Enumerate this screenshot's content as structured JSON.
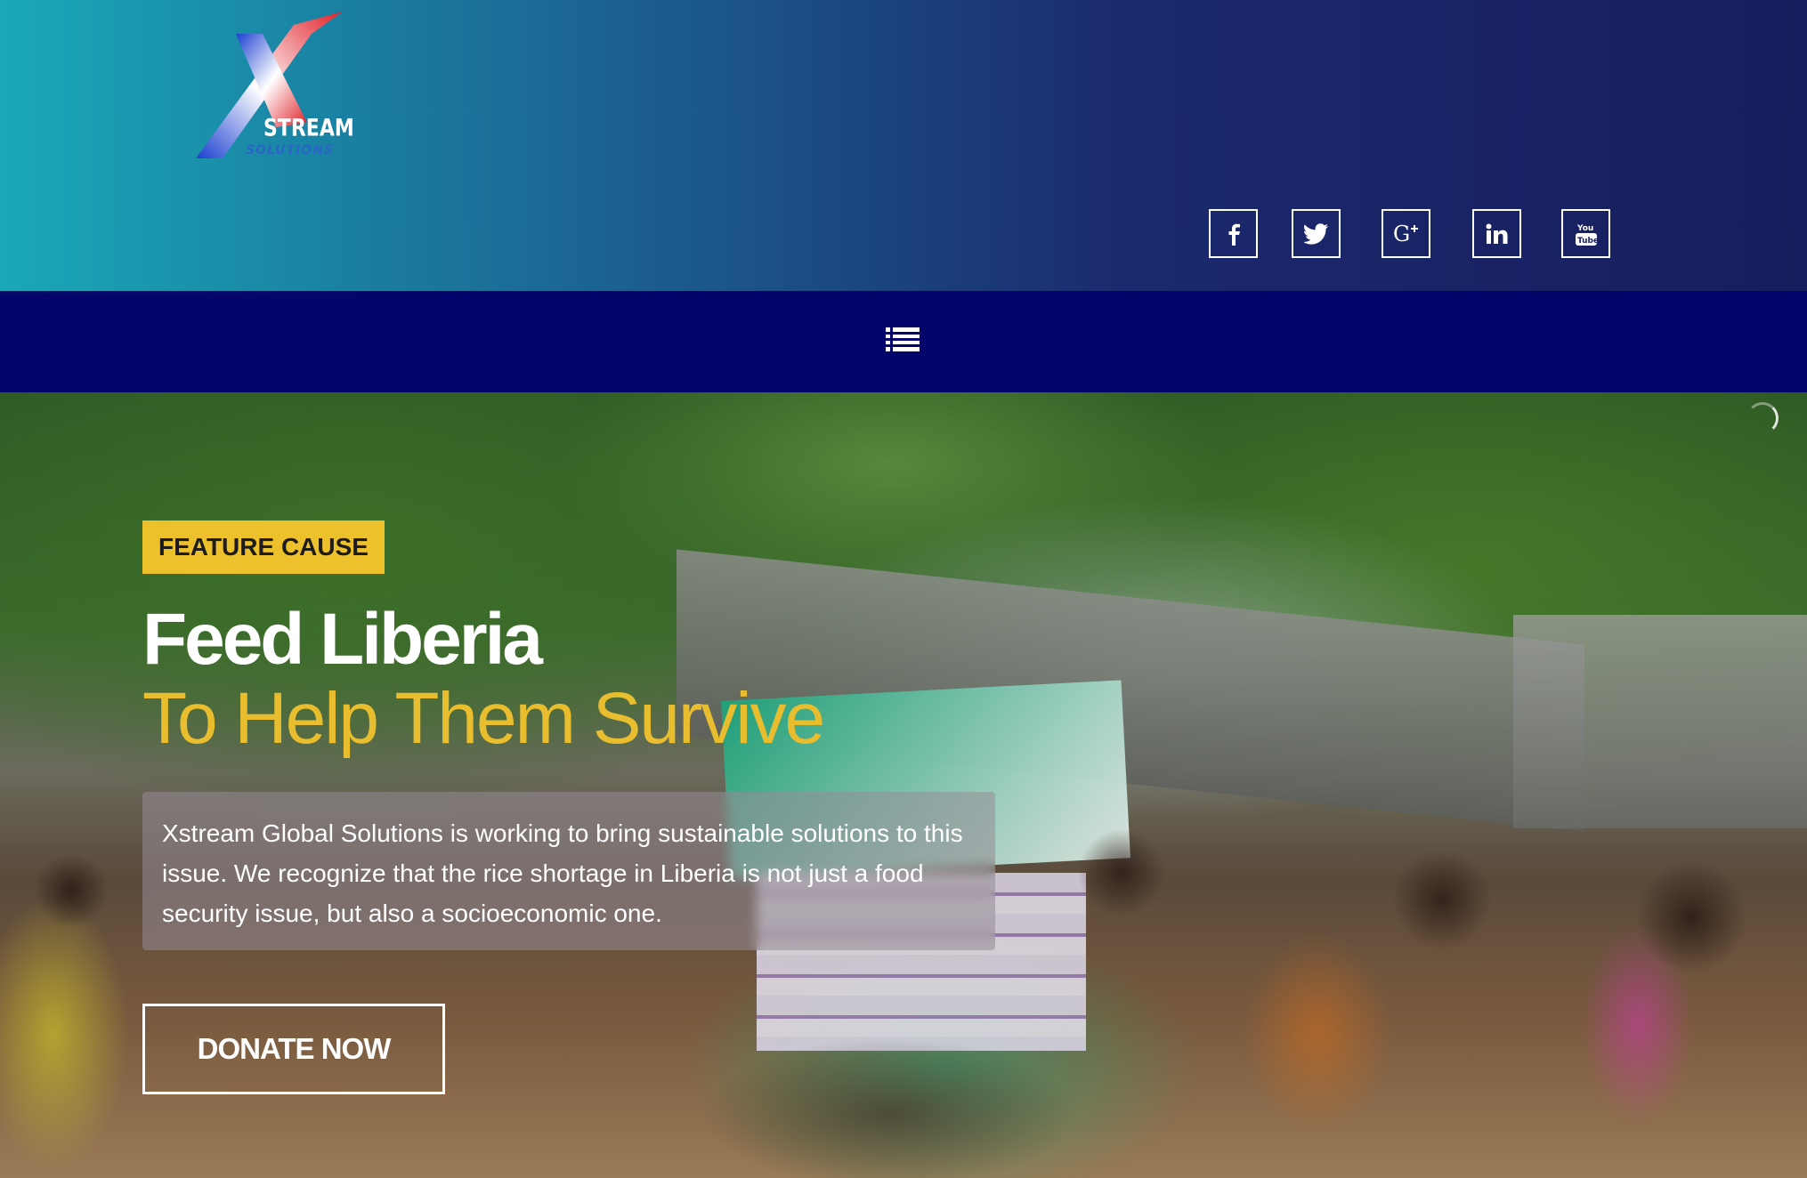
{
  "brand": {
    "logo_word": "STREAM",
    "logo_sub": "SOLUTIONS"
  },
  "social": [
    {
      "name": "facebook-icon",
      "label": "f"
    },
    {
      "name": "twitter-icon",
      "label": "twitter"
    },
    {
      "name": "google-plus-icon",
      "label": "G+"
    },
    {
      "name": "linkedin-icon",
      "label": "in"
    },
    {
      "name": "youtube-icon",
      "label": "You Tube"
    }
  ],
  "nav": {
    "menu_icon": "list-menu-icon"
  },
  "hero": {
    "tag": "FEATURE CAUSE",
    "title": "Feed Liberia",
    "subtitle": "To Help Them Survive",
    "description": "Xstream Global Solutions is working to bring sustainable solutions to this issue. We recognize that the rice shortage in Liberia is not just a food security issue, but also a socioeconomic one.",
    "cta": "DONATE NOW"
  },
  "colors": {
    "accent": "#edc12c",
    "nav": "#03056b",
    "header_start": "#1aa8b8",
    "header_end": "#171d5c"
  }
}
